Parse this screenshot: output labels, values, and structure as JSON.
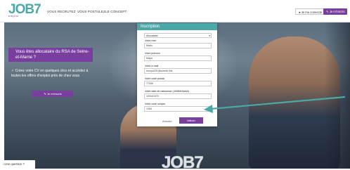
{
  "header": {
    "logo_text": "JOB",
    "logo_number": "7",
    "logo_sub": "emploi",
    "nav": [
      "VOUS RECRUTEZ",
      "VOUS POSTULEZ",
      "LE CONCEPT"
    ],
    "connect_label": "Je me connecte",
    "signup_label": "Je m'inscris"
  },
  "hero": {
    "title": "Vous êtes allocataire du RSA de Seine-et-Marne ?",
    "text": "Créez votre CV en quelques clics et accédez à toutes les offres d'emploi près de chez vous",
    "cta": "Je m'inscris",
    "bottom_logo": "JOB7",
    "question": "Une question ?"
  },
  "form": {
    "title": "Inscription",
    "status_select": "Allocataire",
    "fields": [
      {
        "label": "Votre nom",
        "value": "Malin"
      },
      {
        "label": "Votre prénom",
        "value": "Maya"
      },
      {
        "label": "Votre e-mail",
        "value": "soorya201@sosmb.link"
      },
      {
        "label": "Votre code postal",
        "value": "77000"
      },
      {
        "label": "Votre date de naissance (JJ/MM/AAAA)",
        "value": "10/04/1970"
      },
      {
        "label": "Votre code unique",
        "value": "1364"
      }
    ],
    "cancel": "Annuler",
    "submit": "Valider"
  },
  "colors": {
    "teal": "#4aa9a6",
    "purple": "#7a3f9e"
  }
}
